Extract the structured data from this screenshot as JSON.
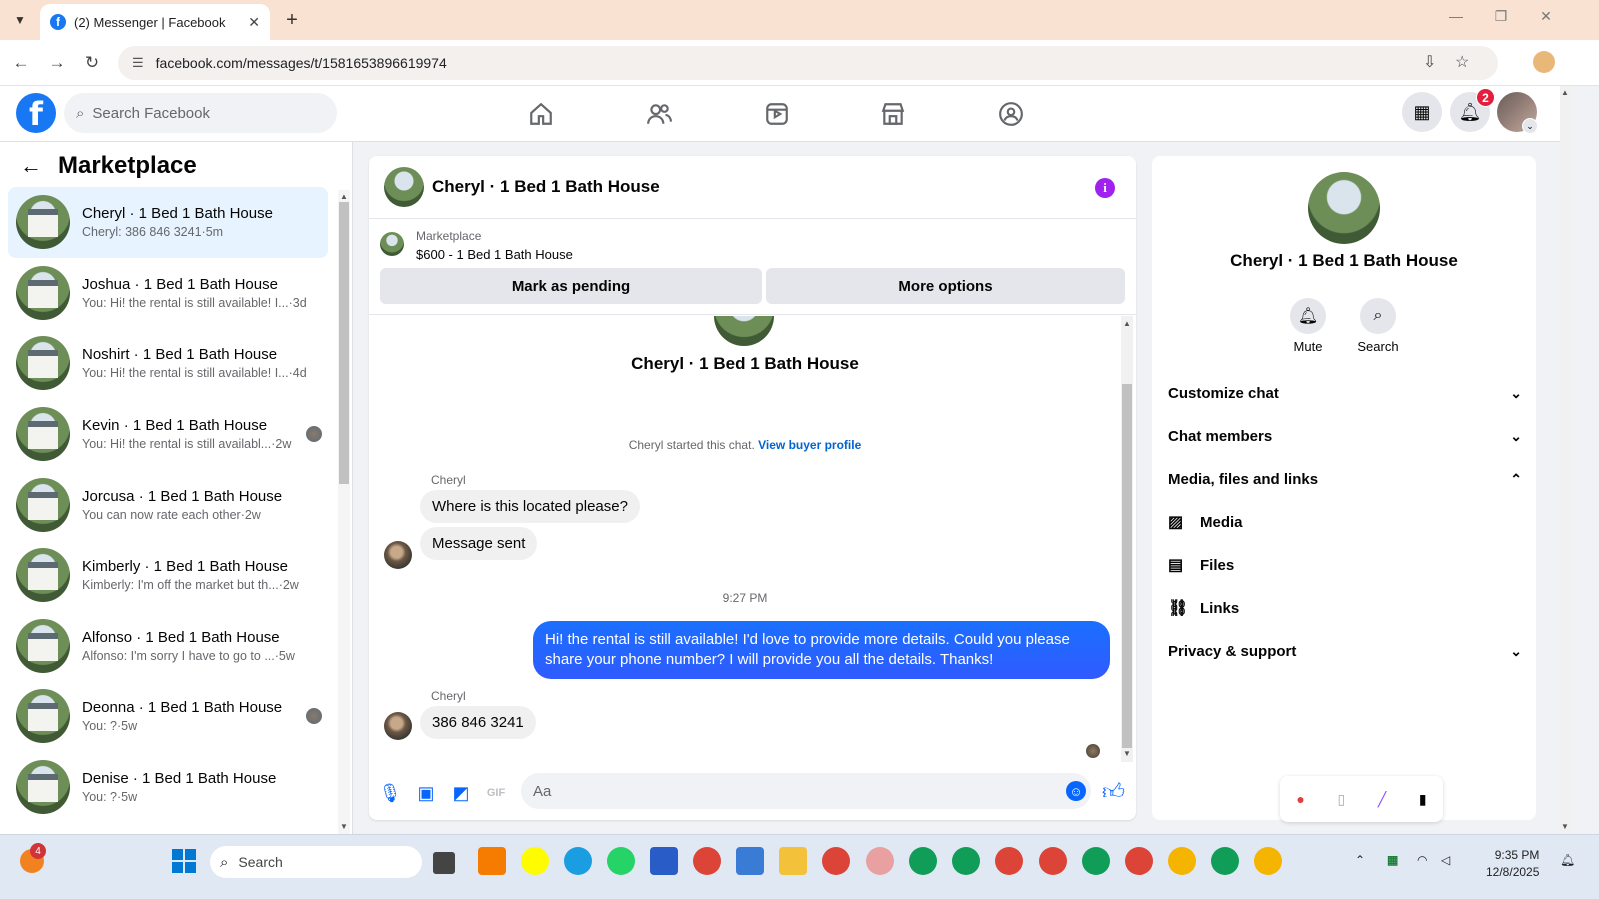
{
  "browser": {
    "tab_title": "(2) Messenger | Facebook",
    "url": "facebook.com/messages/t/1581653896619974"
  },
  "fb_header": {
    "search_placeholder": "Search Facebook",
    "notification_count": "2"
  },
  "left": {
    "title": "Marketplace",
    "conversations": [
      {
        "name": "Cheryl · 1 Bed 1 Bath House",
        "snippet": "Cheryl: 386 846 3241",
        "time": "·5m",
        "active": true
      },
      {
        "name": "Joshua · 1 Bed 1 Bath House",
        "snippet": "You: Hi! the rental is still available! I...",
        "time": "·3d"
      },
      {
        "name": "Noshirt · 1 Bed 1 Bath House",
        "snippet": "You: Hi! the rental is still available! I...",
        "time": "·4d"
      },
      {
        "name": "Kevin · 1 Bed 1 Bath House",
        "snippet": "You: Hi! the rental is still availabl...",
        "time": "·2w"
      },
      {
        "name": "Jorcusa · 1 Bed 1 Bath House",
        "snippet": "You can now rate each other",
        "time": "·2w"
      },
      {
        "name": "Kimberly · 1 Bed 1 Bath House",
        "snippet": "Kimberly: I'm off the market but th...",
        "time": "·2w"
      },
      {
        "name": "Alfonso · 1 Bed 1 Bath House",
        "snippet": "Alfonso: I'm sorry I have to go to ...",
        "time": "·5w"
      },
      {
        "name": "Deonna · 1 Bed 1 Bath House",
        "snippet": "You: ?",
        "time": "·5w"
      },
      {
        "name": "Denise · 1 Bed 1 Bath House",
        "snippet": "You: ?",
        "time": "·5w"
      }
    ]
  },
  "chat": {
    "title": "Cheryl · 1 Bed 1 Bath House",
    "marketplace_label": "Marketplace",
    "listing": "$600 - 1 Bed 1 Bath House",
    "mark_pending": "Mark as pending",
    "more_options": "More options",
    "intro_name": "Cheryl · 1 Bed 1 Bath House",
    "started_text": "Cheryl started this chat.",
    "view_profile": "View buyer profile",
    "sender1": "Cheryl",
    "msg1": "Where is this located please?",
    "msg2": "Message sent",
    "timestamp": "9:27 PM",
    "outgoing": "Hi! the rental is still available! I'd love to provide more details. Could you please share your phone number? I will provide you all the details. Thanks!",
    "sender2": "Cheryl",
    "msg3": "386 846 3241",
    "composer_placeholder": "Aa"
  },
  "right": {
    "name": "Cheryl · 1 Bed 1 Bath House",
    "mute": "Mute",
    "search": "Search",
    "customize": "Customize chat",
    "members": "Chat members",
    "media_files_links": "Media, files and links",
    "media": "Media",
    "files": "Files",
    "links": "Links",
    "privacy": "Privacy & support"
  },
  "taskbar": {
    "search_label": "Search",
    "weather_badge": "4",
    "time": "9:35 PM",
    "date": "12/8/2025"
  },
  "colors": {
    "brand": "#1877f2",
    "outgoing_bubble": "#2f5bff",
    "link": "#0064d1"
  }
}
